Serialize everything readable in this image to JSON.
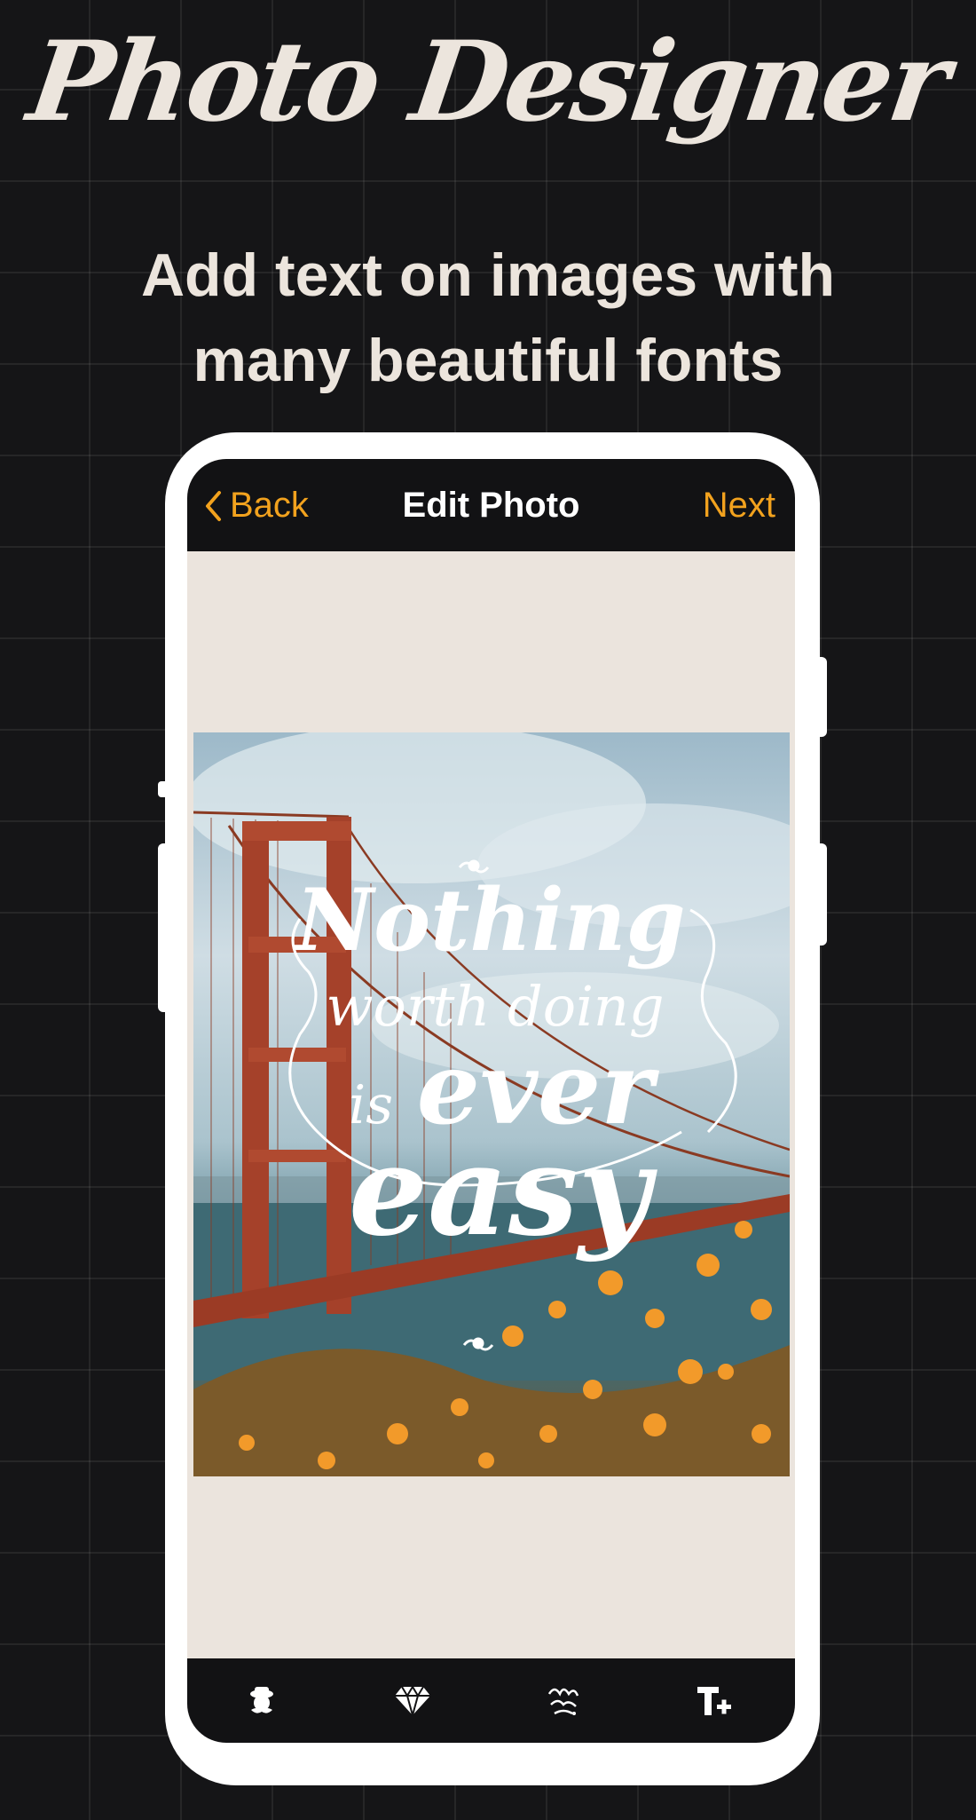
{
  "promo": {
    "title": "Photo Designer",
    "subtitle_line1": "Add text on images with",
    "subtitle_line2": "many beautiful fonts"
  },
  "topbar": {
    "back_label": "Back",
    "title": "Edit Photo",
    "next_label": "Next"
  },
  "overlay_text": {
    "line1": "Nothing",
    "line2": "worth doing",
    "line3_small": "is",
    "line3_big": "ever",
    "line4": "easy"
  },
  "toolbar": {
    "tools": [
      {
        "icon": "sticker-mascot-icon"
      },
      {
        "icon": "diamond-icon"
      },
      {
        "icon": "text-art-icon"
      },
      {
        "icon": "add-text-icon"
      }
    ]
  },
  "colors": {
    "accent": "#f2a21e",
    "background": "#151517",
    "screen": "#ebe4dd",
    "promo_text": "#ece5dd"
  }
}
